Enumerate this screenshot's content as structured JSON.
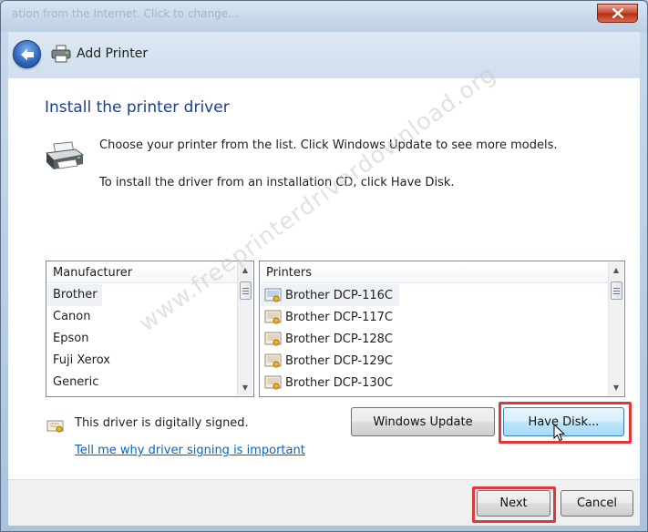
{
  "window": {
    "titlebar_text": "ation from the Internet. Click to change...",
    "close_symbol": "✕",
    "accent": "#c6462a"
  },
  "nav": {
    "back_icon": "back-arrow-icon",
    "printer_icon": "printer-icon",
    "title": "Add Printer"
  },
  "main": {
    "heading": "Install the printer driver",
    "instruction_1": "Choose your printer from the list. Click Windows Update to see more models.",
    "instruction_2": "To install the driver from an installation CD, click Have Disk.",
    "heading_color": "#1e3f8f"
  },
  "manufacturer_list": {
    "header": "Manufacturer",
    "items": [
      "Brother",
      "Canon",
      "Epson",
      "Fuji Xerox",
      "Generic"
    ],
    "selected": "Brother"
  },
  "printer_list": {
    "header": "Printers",
    "items": [
      "Brother DCP-116C",
      "Brother DCP-117C",
      "Brother DCP-128C",
      "Brother DCP-129C",
      "Brother DCP-130C"
    ],
    "selected": "Brother DCP-116C"
  },
  "signing": {
    "status_text": "This driver is digitally signed.",
    "link_text": "Tell me why driver signing is important",
    "link_color": "#0066cc"
  },
  "buttons": {
    "windows_update": "Windows Update",
    "have_disk": "Have Disk...",
    "next": "Next",
    "cancel": "Cancel"
  },
  "annotation": {
    "highlight_color": "#e0373a",
    "watermark": "www.freeprinterdriverdownload.org"
  }
}
